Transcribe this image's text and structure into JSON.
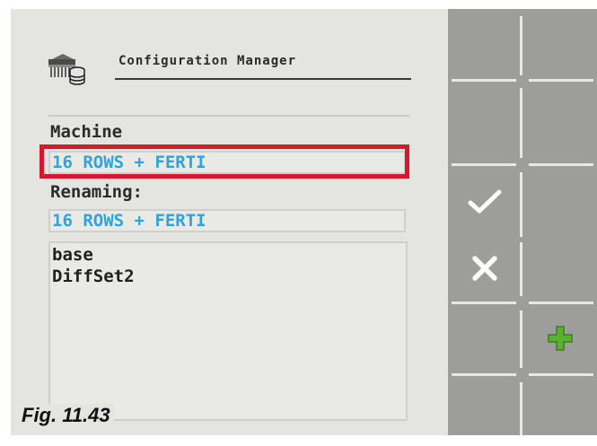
{
  "header": {
    "title": "Configuration Manager",
    "icon": "seed-drill-database-icon"
  },
  "machine": {
    "label": "Machine",
    "value": "16 ROWS + FERTI"
  },
  "renaming": {
    "label": "Renaming:",
    "value": "16 ROWS + FERTI"
  },
  "configurations": [
    "base",
    "DiffSet2"
  ],
  "softkeys": {
    "confirm": "checkmark-icon",
    "cancel": "cross-icon",
    "add": "plus-icon"
  },
  "colors": {
    "highlight": "#d7172b",
    "value_text": "#2fa4dc",
    "plus": "#5cb030"
  },
  "figure_label": "Fig. 11.43"
}
